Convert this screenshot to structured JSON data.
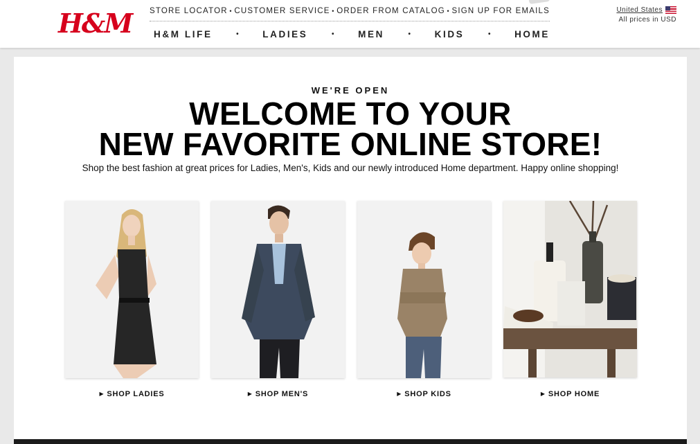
{
  "brand": {
    "logo_text": "H&M",
    "logo_color": "#d6001c"
  },
  "utility_links": [
    "STORE LOCATOR",
    "CUSTOMER SERVICE",
    "ORDER FROM CATALOG",
    "SIGN UP FOR EMAILS"
  ],
  "utility_separator": "•",
  "main_nav": [
    "H&M LIFE",
    "LADIES",
    "MEN",
    "KIDS",
    "HOME"
  ],
  "nav_separator": "•",
  "locale": {
    "country": "United States",
    "prices_note": "All prices in USD",
    "flag_icon": "us-flag-icon"
  },
  "hero": {
    "kicker": "WE'RE OPEN",
    "headline_line1": "WELCOME TO YOUR",
    "headline_line2": "NEW FAVORITE ONLINE STORE!",
    "subline": "Shop the best fashion at great prices for Ladies, Men's, Kids and our newly introduced Home department. Happy online shopping!"
  },
  "categories": [
    {
      "image_name": "ladies-model-image",
      "link_label": "SHOP LADIES"
    },
    {
      "image_name": "mens-model-image",
      "link_label": "SHOP MEN'S"
    },
    {
      "image_name": "kids-model-image",
      "link_label": "SHOP KIDS"
    },
    {
      "image_name": "home-products-image",
      "link_label": "SHOP HOME"
    }
  ],
  "link_arrow_icon": "caret-right-icon",
  "colors": {
    "background": "#e9e9e9",
    "panel": "#ffffff",
    "text": "#111111",
    "footer": "#1b1b1b"
  }
}
